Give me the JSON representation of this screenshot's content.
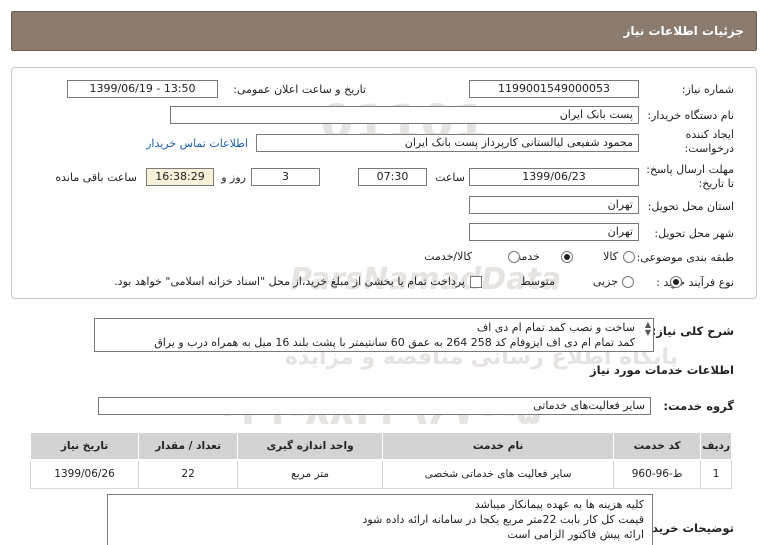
{
  "header": {
    "title": "جزئیات اطلاعات نیاز"
  },
  "fields": {
    "need_number_label": "شماره نیاز:",
    "need_number": "1199001549000053",
    "announce_label": "تاریخ و ساعت اعلان عمومی:",
    "announce_value": "1399/06/19 - 13:50",
    "buyer_label": "نام دستگاه خریدار:",
    "buyer_value": "پست بانک ایران",
    "creator_label_1": "ایجاد کننده",
    "creator_label_2": "درخواست:",
    "creator_value": "محمود شفیعی لیالستانی کارپرداز پست بانک ایران",
    "contact_link": "اطلاعات تماس خریدار",
    "deadline_label_1": "مهلت ارسال پاسخ:",
    "deadline_label_2": "تا تاریخ:",
    "deadline_date": "1399/06/23",
    "time_label": "ساعت",
    "deadline_time": "07:30",
    "days_value": "3",
    "days_label": "روز و",
    "remaining_time": "16:38:29",
    "remaining_label": "ساعت باقی مانده",
    "province_label": "استان محل تحویل:",
    "province_value": "تهران",
    "city_label": "شهر محل تحویل:",
    "city_value": "تهران",
    "category_label": "طبقه بندی موضوعی:",
    "category_options": [
      "کالا",
      "خدمت",
      "کالا/خدمت"
    ],
    "category_selected": "خدمت",
    "process_label": "نوع فرآیند خرید :",
    "process_options": [
      "جزیی",
      "متوسط"
    ],
    "process_selected": "جزیی",
    "payment_note": "پرداخت تمام یا بخشی از مبلغ خرید،از محل \"اسناد خزانه اسلامی\" خواهد بود."
  },
  "description": {
    "label": "شرح کلی نیاز:",
    "line1": "ساخت و نصب کمد تمام ام دی اف",
    "line2": "کمد تمام ام دی اف ایزوفام کد 258 264 به عمق 60 سانتیمتر با پشت بلند 16 میل به همراه درب و یراق"
  },
  "services": {
    "section_title": "اطلاعات خدمات مورد نیاز",
    "group_label": "گروه خدمت:",
    "group_value": "سایر فعالیت‌های خدماتی",
    "columns": [
      "ردیف",
      "کد خدمت",
      "نام خدمت",
      "واحد اندازه گیری",
      "تعداد / مقدار",
      "تاریخ نیاز"
    ],
    "rows": [
      {
        "index": "1",
        "code": "ط-96-960",
        "name": "سایر فعالیت های خدماتی شخصی",
        "unit": "متر مربع",
        "qty": "22",
        "date": "1399/06/26"
      }
    ]
  },
  "buyer_notes": {
    "label": "توضیحات خریدار:",
    "line1": "کلیه هزینه ها به عهده پیمانکار میباشد",
    "line2": "قیمت کل کار بابت 22متر مربع یکجا در سامانه ارائه داده شود",
    "line3": "ارائه پیش فاکتور الزامی است"
  },
  "watermark": {
    "brand": "ParsNamadData",
    "line1": "پایگاه اطلاع رسانی مناقصه و مزایده",
    "phone": "۰۲۱-۸۸۳۴۹۶۷۰-۵"
  }
}
